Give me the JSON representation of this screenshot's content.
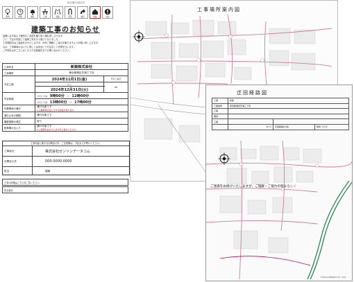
{
  "notice": {
    "date_line": "2024年10月1日",
    "icons": [
      {
        "name": "bulb-icon",
        "caption": "照明"
      },
      {
        "name": "clock-icon",
        "caption": "時間"
      },
      {
        "name": "bell-icon",
        "caption": "騒音"
      },
      {
        "name": "drill-icon",
        "caption": "工事"
      },
      {
        "name": "road-icon",
        "caption": "道路"
      },
      {
        "name": "u-turn-icon",
        "caption": "迂回"
      },
      {
        "name": "arrow-icon",
        "caption": "通行"
      },
      {
        "name": "house-icon",
        "caption": "建築"
      },
      {
        "name": "info-icon",
        "caption": "注意"
      }
    ],
    "title": "建築工事のお知らせ",
    "intro_lines": [
      "皆様には平素より格別のご高配を賜り厚く御礼申し上げます。",
      "さて、下記の内容にて建築工事を行う運びとなりました。",
      "工事期間中はご迷惑をおかけしますが、何卒ご理解とご協力を賜りますようお願い申し上げます。",
      "なお、工事車両の出入りに際しては安全に十分注意して作業を行います。",
      "ご不明な点がございましたら下記連絡先までお問い合わせください。"
    ],
    "rows": {
      "name_label": "工事件名",
      "name_value": "新築株式会社",
      "place_label": "工事場所",
      "place_value": "東京都港区芝浦三丁目",
      "period_label": "予定工期",
      "period_start": "2024年11月1日(金)",
      "period_mid": "から",
      "period_end": "2024年12月31日(火)",
      "days_label": "予定工事日",
      "days_value": "40",
      "time_label": "予定時間",
      "time1_tag": "(平日) 午前",
      "time1_start": "9時00分",
      "time1_sep": "〜",
      "time1_end": "12時00分",
      "time2_tag": "(平日) 午後",
      "time2_start": "13時00分",
      "time2_sep": "〜",
      "time2_end": "17時00分",
      "traffic_label": "作業車両の通行",
      "traffic_value": "通行可能です",
      "traffic_note": "※工事車両が出入りする場合があります",
      "stop_label": "通行止めの期間",
      "stop_value": "通行可能です",
      "noise_label": "騒音振動の発生",
      "noise_value": "有り",
      "detour_label": "駐車場の出入り",
      "detour_value": "通行可能です",
      "detour_note": "※ご迷惑をおかけしますがご協力ください"
    },
    "contact": {
      "header": "工事内容に関するお問合せ先・ご意見等は、下記までお寄せください。",
      "company_label": "工事会社",
      "company_value": "株式会社ゼンリンデータコム",
      "tel_label": "お問合せ先",
      "tel_value": "000-0000-0000",
      "person_label": "担当",
      "person_value": "建築"
    },
    "footer_rows": [
      "工事の詳細はこちらをご覧ください",
      "担当者名"
    ]
  },
  "map1": {
    "title": "工事場所案内図"
  },
  "map2": {
    "title": "迂回経路図",
    "row1_label": "工事",
    "row1_value": "新築",
    "row2_label": "工事場所",
    "row2_value": "東京都港区芝浦三丁目",
    "row3_label": "工事",
    "row4_label": "期間",
    "row5_label": "工事",
    "scale_text": "20 m",
    "detour_label": "迂回距離(片道)",
    "time_label": "時間",
    "time_value": "20 分",
    "copyright": "©2024 ZENRIN CO., LTD."
  },
  "bottom_note": "ご迷惑をお掛けいたしますが、ご理解・ご協力の程よろしく",
  "colors": {
    "accent": "#cc2222",
    "map_road": "#d47a9a",
    "map_block": "#eaeaea",
    "green_road": "#2f8f55"
  }
}
